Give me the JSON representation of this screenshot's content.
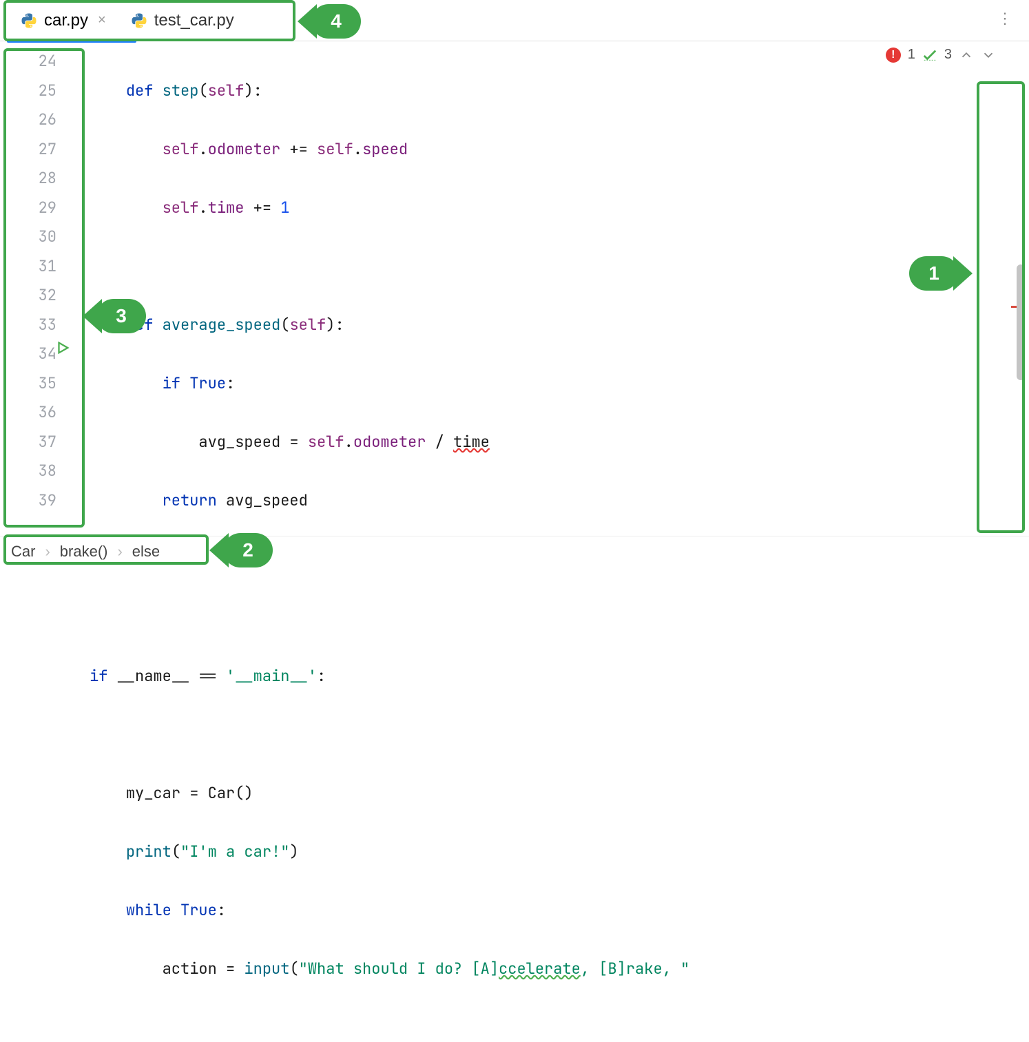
{
  "tabs": [
    {
      "label": "car.py",
      "active": true,
      "closable": true
    },
    {
      "label": "test_car.py",
      "active": false,
      "closable": false
    }
  ],
  "inspections": {
    "errors": "1",
    "warnings": "3"
  },
  "gutter_lines": [
    "24",
    "25",
    "26",
    "27",
    "28",
    "29",
    "30",
    "31",
    "32",
    "33",
    "34",
    "35",
    "36",
    "37",
    "38",
    "39"
  ],
  "code": {
    "l24": {
      "kw": "def",
      "fn": "step",
      "lp": "(",
      "self": "self",
      "rp": "):"
    },
    "l25": {
      "self": "self",
      "dot": ".",
      "prop": "odometer",
      "op": " += ",
      "self2": "self",
      "dot2": ".",
      "prop2": "speed"
    },
    "l26": {
      "self": "self",
      "dot": ".",
      "prop": "time",
      "op": " += ",
      "num": "1"
    },
    "l28": {
      "kw": "def",
      "fn": "average_speed",
      "lp": "(",
      "self": "self",
      "rp": "):"
    },
    "l29": {
      "kw": "if",
      "val": "True",
      "colon": ":"
    },
    "l30": {
      "v": "avg_speed = ",
      "self": "self",
      "dot": ".",
      "prop": "odometer",
      "op": " / ",
      "err": "time"
    },
    "l31": {
      "kw": "return",
      "v": " avg_speed"
    },
    "l34": {
      "kw": "if",
      "name": " __name__ == ",
      "str": "'__main__'",
      "colon": ":"
    },
    "l36": {
      "v": "my_car = Car()"
    },
    "l37": {
      "fn": "print",
      "lp": "(",
      "str": "\"I'm a car!\"",
      "rp": ")"
    },
    "l38": {
      "kw": "while",
      "val": "True",
      "colon": ":"
    },
    "l39": {
      "v": "action = ",
      "fn": "input",
      "lp": "(",
      "str1": "\"What should I do? [A]",
      "warn": "ccelerate",
      "str2": ", [B]rake, \""
    }
  },
  "breadcrumb": {
    "a": "Car",
    "b": "brake()",
    "c": "else"
  },
  "callouts": {
    "c1": "1",
    "c2": "2",
    "c3": "3",
    "c4": "4"
  }
}
